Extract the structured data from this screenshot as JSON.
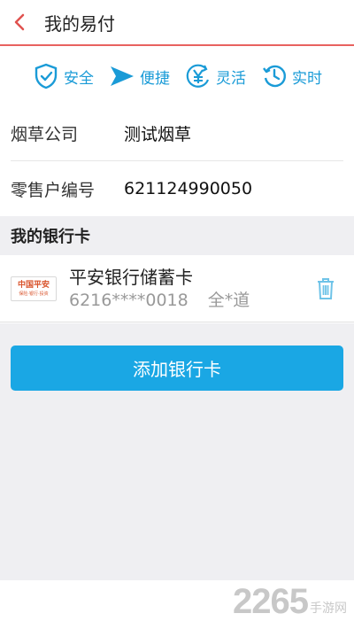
{
  "header": {
    "title": "我的易付"
  },
  "features": [
    {
      "label": "安全",
      "icon": "shield-check-icon"
    },
    {
      "label": "便捷",
      "icon": "paper-plane-icon"
    },
    {
      "label": "灵活",
      "icon": "yen-icon"
    },
    {
      "label": "实时",
      "icon": "clock-history-icon"
    }
  ],
  "info": {
    "company_label": "烟草公司",
    "company_value": "测试烟草",
    "retailer_label": "零售户编号",
    "retailer_value": "621124990050"
  },
  "section": {
    "title": "我的银行卡"
  },
  "card": {
    "bank_logo_text": "中国平安",
    "bank_logo_sub": "保险·银行·投资",
    "name": "平安银行储蓄卡",
    "number": "6216****0018",
    "holder": "全*道"
  },
  "actions": {
    "add_card_label": "添加银行卡"
  },
  "watermark": {
    "number": "2265",
    "site": "手游网"
  },
  "colors": {
    "accent": "#1aa7e4",
    "header_line": "#e8625f",
    "feature_blue": "#1a9bd7"
  }
}
